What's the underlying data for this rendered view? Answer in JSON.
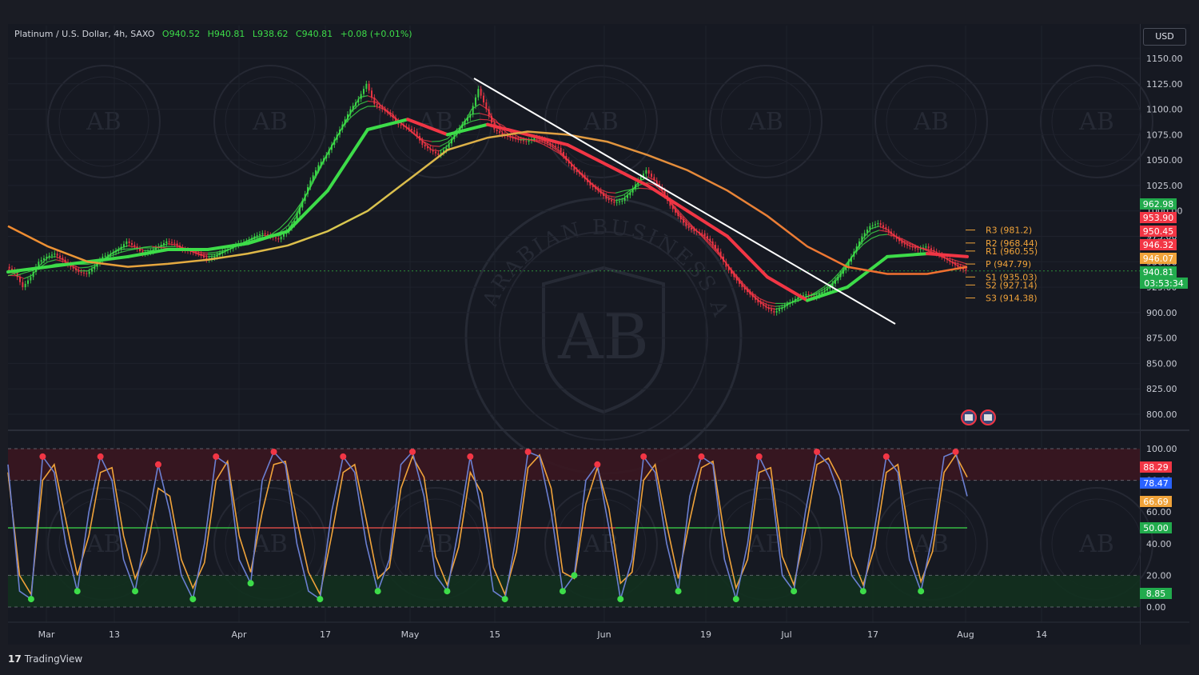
{
  "header": {
    "symbol": "Platinum / U.S. Dollar, 4h, SAXO",
    "open": "O940.52",
    "high": "H940.81",
    "low": "L938.62",
    "close": "C940.81",
    "change": "+0.08 (+0.01%)",
    "currency": "USD"
  },
  "watermark": {
    "logo": "AB",
    "name": "ARABIAN BUSINESS ACADEMY"
  },
  "brand": {
    "name": "TradingView",
    "logo": "17"
  },
  "colors": {
    "up": "#3ddc49",
    "down": "#f23645",
    "pivot": "#f0a33a",
    "trend": "#ffffff"
  },
  "chart_data": [
    {
      "type": "line",
      "title": "Platinum / U.S. Dollar, 4h, SAXO",
      "x_ticks": [
        "Mar",
        "13",
        "Apr",
        "17",
        "May",
        "15",
        "Jun",
        "19",
        "Jul",
        "17",
        "Aug",
        "14"
      ],
      "y_ticks": [
        "1150.00",
        "1125.00",
        "1100.00",
        "1075.00",
        "1050.00",
        "1025.00",
        "1000.00",
        "975.00",
        "950.00",
        "925.00",
        "900.00",
        "875.00",
        "850.00",
        "825.00",
        "800.00"
      ],
      "ylim": [
        785,
        1160
      ],
      "series": [
        {
          "name": "",
          "role": "price",
          "x": [
            0,
            10,
            20,
            30,
            40,
            50,
            60,
            70,
            80,
            90,
            100,
            110,
            120,
            130,
            140,
            150,
            160,
            170,
            180,
            190,
            200,
            210,
            220,
            230,
            240,
            250,
            260,
            270,
            280,
            290,
            300,
            310,
            320,
            330,
            340,
            350,
            360,
            370,
            380,
            390,
            400,
            410,
            420,
            430,
            440,
            450,
            460,
            470,
            480,
            490,
            500,
            510,
            520,
            530,
            540,
            550,
            560,
            570,
            580,
            590,
            600,
            610,
            620,
            630,
            640,
            650,
            660,
            670,
            680,
            690,
            700,
            710,
            720,
            730,
            740,
            750,
            760,
            770,
            780,
            790,
            800,
            810,
            820,
            830,
            840,
            850,
            860,
            870,
            880,
            890,
            900,
            910,
            920,
            930,
            940,
            950,
            960,
            970,
            980,
            990,
            1000,
            1010,
            1020,
            1030,
            1040,
            1050,
            1060,
            1070,
            1080,
            1090,
            1100,
            1110,
            1120,
            1130,
            1140,
            1150,
            1160,
            1170,
            1180,
            1190,
            1200
          ],
          "y": [
            945,
            940,
            925,
            935,
            950,
            955,
            958,
            952,
            945,
            940,
            938,
            945,
            955,
            958,
            962,
            970,
            965,
            958,
            960,
            965,
            970,
            968,
            962,
            960,
            958,
            952,
            955,
            960,
            963,
            968,
            970,
            975,
            978,
            975,
            972,
            980,
            990,
            1010,
            1030,
            1045,
            1055,
            1070,
            1085,
            1100,
            1110,
            1125,
            1105,
            1100,
            1095,
            1085,
            1082,
            1078,
            1065,
            1060,
            1055,
            1062,
            1075,
            1085,
            1095,
            1120,
            1100,
            1080,
            1075,
            1072,
            1070,
            1068,
            1072,
            1070,
            1065,
            1062,
            1050,
            1040,
            1035,
            1025,
            1020,
            1012,
            1008,
            1010,
            1018,
            1030,
            1040,
            1030,
            1020,
            1005,
            995,
            985,
            980,
            978,
            970,
            960,
            945,
            935,
            925,
            918,
            910,
            905,
            900,
            905,
            910,
            915,
            918,
            915,
            920,
            925,
            935,
            945,
            960,
            975,
            985,
            988,
            982,
            975,
            968,
            965,
            962,
            965,
            960,
            955,
            950,
            945,
            941
          ]
        },
        {
          "name": "",
          "role": "fast MA",
          "color": "#3ddc49",
          "x": [
            0,
            100,
            150,
            200,
            250,
            300,
            350,
            400,
            450,
            500,
            550,
            600,
            650,
            700,
            750,
            800,
            850,
            900,
            950,
            1000,
            1050,
            1100,
            1150,
            1200
          ],
          "y": [
            940,
            950,
            955,
            962,
            962,
            968,
            980,
            1020,
            1080,
            1090,
            1075,
            1085,
            1075,
            1065,
            1045,
            1025,
            1000,
            975,
            935,
            912,
            925,
            955,
            958,
            955
          ]
        },
        {
          "name": "",
          "role": "slow MA",
          "color": "#e0c050",
          "x": [
            0,
            50,
            100,
            150,
            200,
            250,
            300,
            350,
            400,
            450,
            500,
            550,
            600,
            650,
            700,
            750,
            800,
            850,
            900,
            950,
            1000,
            1050,
            1100,
            1150,
            1200
          ],
          "y": [
            985,
            965,
            950,
            945,
            948,
            952,
            958,
            966,
            980,
            1000,
            1030,
            1060,
            1072,
            1078,
            1075,
            1068,
            1055,
            1040,
            1020,
            995,
            965,
            945,
            938,
            938,
            945
          ]
        }
      ],
      "trendline": {
        "from": [
          1110,
          1128
        ],
        "to": [
          1640,
          888
        ]
      },
      "pivots": [
        {
          "label": "R3",
          "value": 981.2
        },
        {
          "label": "R2",
          "value": 968.44
        },
        {
          "label": "R1",
          "value": 960.55
        },
        {
          "label": "P",
          "value": 947.79
        },
        {
          "label": "S1",
          "value": 935.03
        },
        {
          "label": "S2",
          "value": 927.14
        },
        {
          "label": "S3",
          "value": 914.38
        }
      ],
      "price_tags": [
        {
          "value": "962.98",
          "color": "#22ab4d"
        },
        {
          "value": "953.90",
          "color": "#f23645"
        },
        {
          "value": "950.45",
          "color": "#f23645"
        },
        {
          "value": "946.32",
          "color": "#f23645"
        },
        {
          "value": "946.07",
          "color": "#f0a33a"
        },
        {
          "value": "940.81",
          "color": "#22ab4d"
        }
      ],
      "countdown": "03:53:34"
    },
    {
      "type": "line",
      "title": "",
      "y_ticks": [
        "100.00",
        "80.00",
        "60.00",
        "40.00",
        "20.00",
        "0.00"
      ],
      "ylim": [
        0,
        100
      ],
      "levels": [
        80,
        50,
        20
      ],
      "series": [
        {
          "name": "",
          "role": "%K",
          "color": "#6b7fd1",
          "y": [
            90,
            10,
            5,
            95,
            85,
            40,
            10,
            60,
            95,
            80,
            30,
            10,
            50,
            90,
            60,
            20,
            5,
            40,
            95,
            90,
            30,
            15,
            80,
            98,
            90,
            40,
            10,
            5,
            60,
            95,
            85,
            40,
            10,
            30,
            90,
            98,
            70,
            20,
            10,
            50,
            95,
            60,
            10,
            5,
            45,
            98,
            95,
            60,
            10,
            20,
            80,
            90,
            50,
            5,
            30,
            95,
            85,
            40,
            10,
            70,
            95,
            90,
            30,
            5,
            40,
            95,
            80,
            20,
            10,
            60,
            98,
            90,
            70,
            20,
            10,
            50,
            95,
            85,
            30,
            10,
            45,
            95,
            98,
            70
          ]
        },
        {
          "name": "",
          "role": "%D",
          "color": "#f0a33a",
          "y": [
            85,
            20,
            8,
            80,
            90,
            55,
            20,
            45,
            85,
            88,
            45,
            18,
            35,
            75,
            70,
            30,
            12,
            28,
            80,
            92,
            45,
            22,
            60,
            90,
            92,
            55,
            22,
            8,
            45,
            85,
            90,
            55,
            18,
            25,
            75,
            95,
            82,
            32,
            14,
            38,
            85,
            72,
            25,
            8,
            35,
            88,
            96,
            75,
            22,
            18,
            65,
            88,
            62,
            15,
            22,
            80,
            90,
            52,
            18,
            55,
            88,
            92,
            45,
            12,
            30,
            85,
            88,
            32,
            14,
            48,
            90,
            94,
            80,
            32,
            14,
            38,
            85,
            90,
            45,
            16,
            35,
            85,
            96,
            82
          ]
        }
      ],
      "tags": [
        {
          "value": "88.29",
          "color": "#f23645"
        },
        {
          "value": "78.47",
          "color": "#2962ff"
        },
        {
          "value": "66.69",
          "color": "#f0a33a"
        },
        {
          "value": "50.00",
          "color": "#22ab4d"
        },
        {
          "value": "8.85",
          "color": "#22ab4d"
        }
      ]
    }
  ]
}
